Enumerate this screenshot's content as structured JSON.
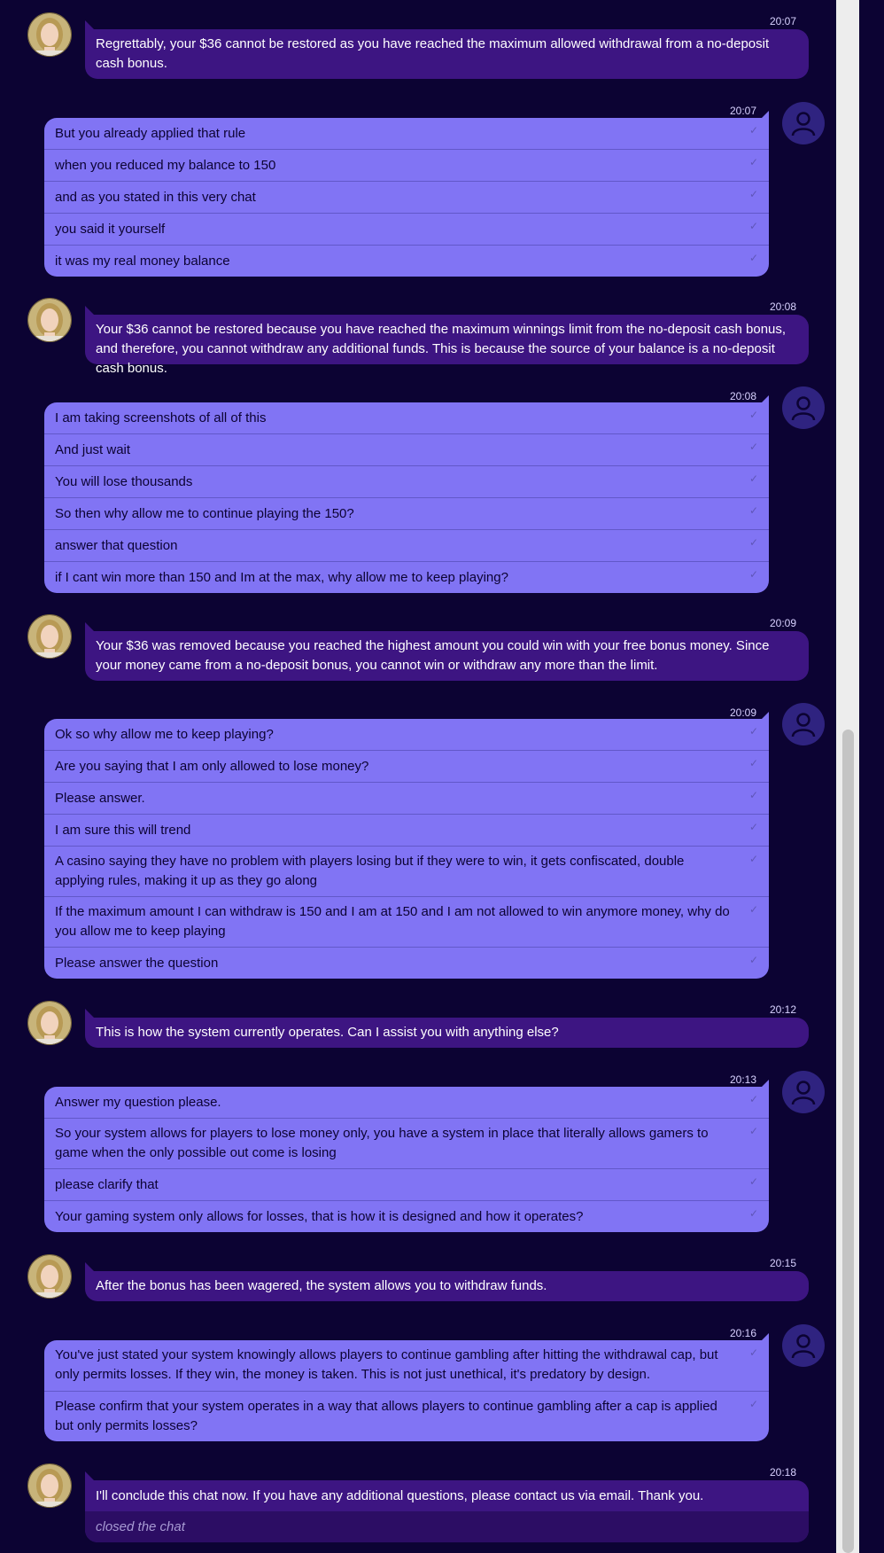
{
  "colors": {
    "background": "#0c0333",
    "agent_bubble": "#3d1582",
    "user_bubble": "#8174f4",
    "timestamp": "#d8d2ff",
    "scrollbar": "#ededed"
  },
  "icons": {
    "agent_avatar": "agent-photo-icon",
    "user_avatar": "user-silhouette-icon",
    "read_receipt": "check-icon"
  },
  "messages": [
    {
      "sender": "agent",
      "time": "20:07",
      "lines": [
        "Regrettably, your $36 cannot be restored as you have reached the maximum allowed withdrawal from a no-deposit cash bonus."
      ]
    },
    {
      "sender": "user",
      "time": "20:07",
      "lines": [
        "But you already applied that rule",
        "when you reduced my balance to 150",
        "and as you stated in this very chat",
        "you said it yourself",
        "it was my real money balance"
      ]
    },
    {
      "sender": "agent",
      "time": "20:08",
      "lines": [
        "Your $36 cannot be restored because you have reached the maximum winnings limit from the no-deposit cash bonus, and therefore, you cannot withdraw any additional funds. This is because the source of your balance is a no-deposit cash bonus."
      ]
    },
    {
      "sender": "user",
      "time": "20:08",
      "lines": [
        "I am taking screenshots of all of this",
        "And just wait",
        "You will lose thousands",
        "So then why allow me to continue playing the 150?",
        "answer that question",
        "if I cant win more than 150 and Im at the max, why allow me to keep playing?"
      ]
    },
    {
      "sender": "agent",
      "time": "20:09",
      "lines": [
        "Your $36 was removed because you reached the highest amount you could win with your free bonus money. Since your money came from a no-deposit bonus, you cannot win or withdraw any more than the limit."
      ]
    },
    {
      "sender": "user",
      "time": "20:09",
      "lines": [
        "Ok so why allow me to keep playing?",
        "Are you saying that I am only allowed to lose money?",
        "Please answer.",
        "I am sure this will trend",
        "A casino saying they have no problem with players losing but if they were to win, it gets confiscated, double applying rules, making it up as they go along",
        "If the maximum amount I can withdraw is 150 and I am at 150 and I am not allowed to win anymore money, why do you allow me to keep playing",
        "Please answer the question"
      ]
    },
    {
      "sender": "agent",
      "time": "20:12",
      "lines": [
        "This is how the system currently operates. Can I assist you with anything else?"
      ]
    },
    {
      "sender": "user",
      "time": "20:13",
      "lines": [
        "Answer my question please.",
        "So your system allows for players to lose money only, you have a system in place that literally allows gamers to game when the only possible out come is losing",
        "please clarify that",
        "Your gaming system only allows for losses, that is how it is designed and how it operates?"
      ]
    },
    {
      "sender": "agent",
      "time": "20:15",
      "lines": [
        "After the bonus has been wagered, the system allows you to withdraw funds."
      ]
    },
    {
      "sender": "user",
      "time": "20:16",
      "lines": [
        "You've just stated your system knowingly allows players to continue gambling after hitting the withdrawal cap, but only permits losses. If they win, the money is taken. This is not just unethical, it's predatory by design.",
        "Please confirm that your system operates in a way that allows players to continue gambling after a cap is applied but only permits losses?"
      ]
    },
    {
      "sender": "agent",
      "time": "20:18",
      "lines": [
        "I'll conclude this chat now. If you have any additional questions, please contact us via email. Thank you."
      ],
      "closed_text": "closed the chat"
    }
  ]
}
